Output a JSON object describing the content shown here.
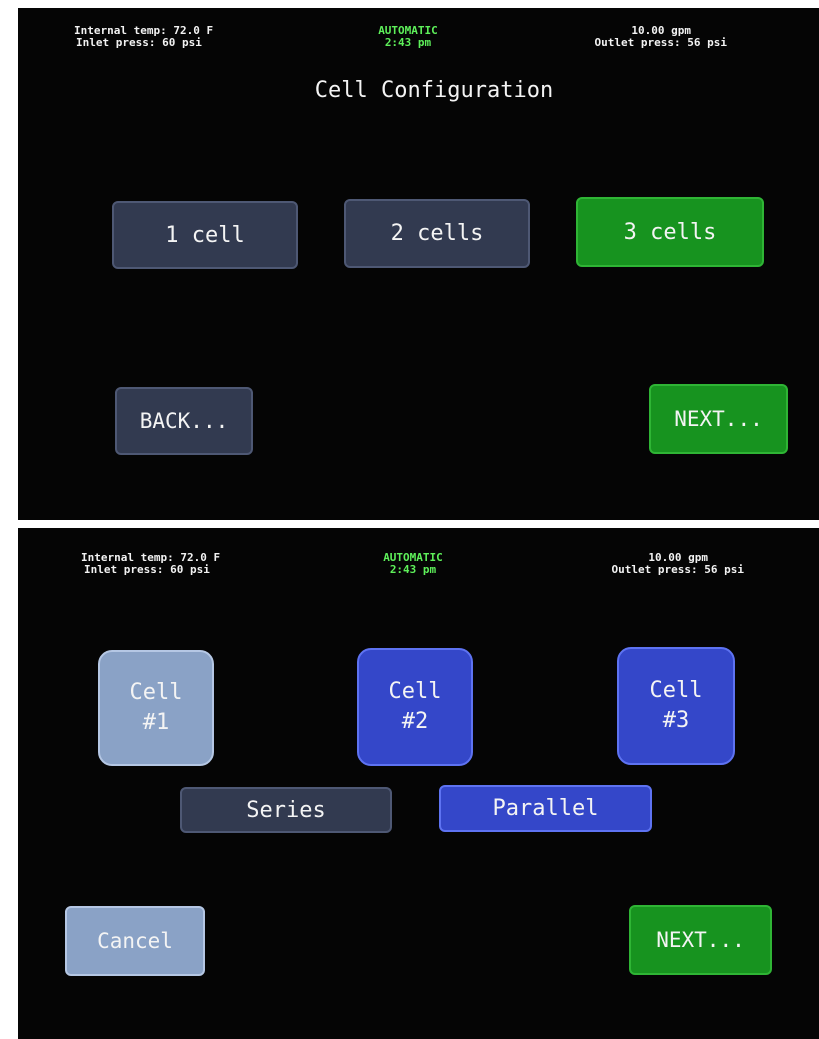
{
  "screen1": {
    "status": {
      "left_line1": "Internal temp: 72.0 F",
      "left_line2": "Inlet press: 60 psi",
      "center_line1": "AUTOMATIC",
      "center_line2": "2:43 pm",
      "right_line1": "10.00 gpm",
      "right_line2": "Outlet press: 56 psi"
    },
    "title": "Cell Configuration",
    "options": [
      {
        "label": "1 cell",
        "selected": false
      },
      {
        "label": "2 cells",
        "selected": false
      },
      {
        "label": "3 cells",
        "selected": true
      }
    ],
    "back_label": "BACK...",
    "next_label": "NEXT..."
  },
  "screen2": {
    "status": {
      "left_line1": "Internal temp: 72.0 F",
      "left_line2": "Inlet press: 60 psi",
      "center_line1": "AUTOMATIC",
      "center_line2": "2:43 pm",
      "right_line1": "10.00 gpm",
      "right_line2": "Outlet press: 56 psi"
    },
    "cells": [
      {
        "line1": "Cell",
        "line2": "#1"
      },
      {
        "line1": "Cell",
        "line2": "#2"
      },
      {
        "line1": "Cell",
        "line2": "#3"
      }
    ],
    "series_label": "Series",
    "parallel_label": "Parallel",
    "cancel_label": "Cancel",
    "next_label": "NEXT..."
  },
  "colors": {
    "status_green": "#5ef05a",
    "button_slate": "#323a50",
    "button_green": "#17931f",
    "button_blue": "#3447c9",
    "button_light_blue": "#8aa2c6"
  }
}
